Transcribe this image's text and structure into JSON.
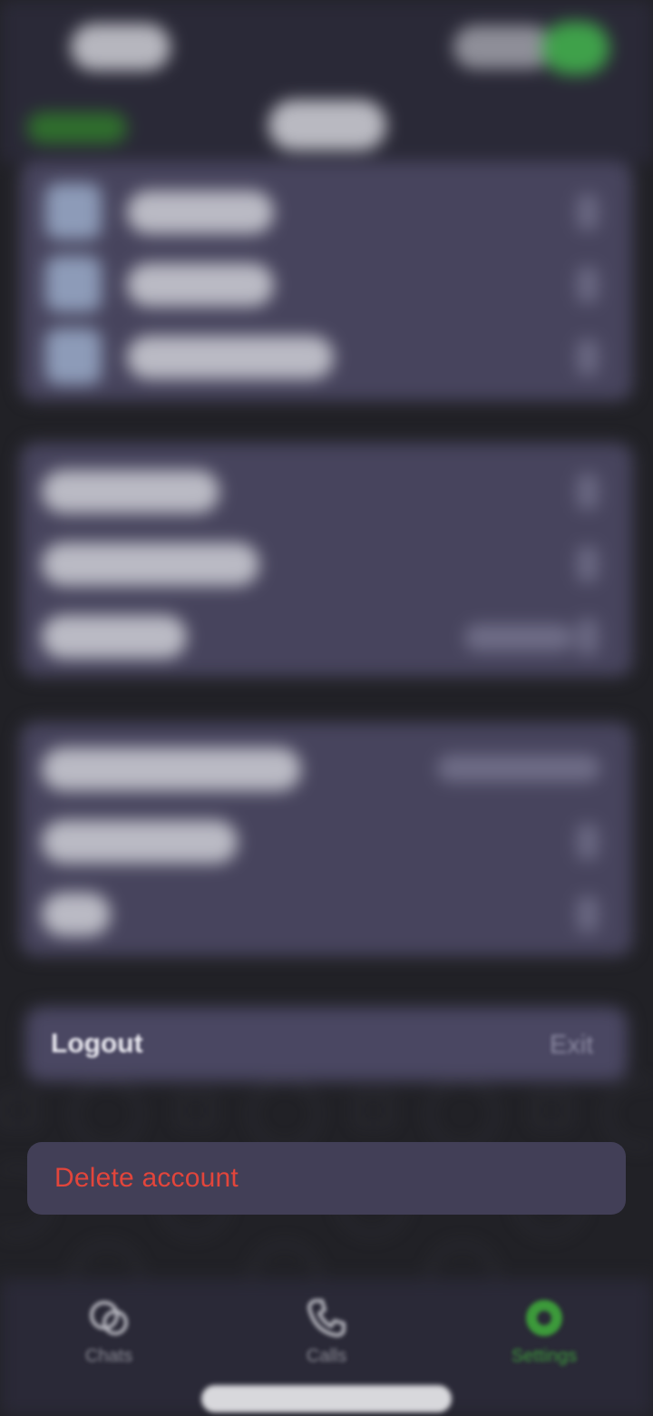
{
  "settings_list": {
    "logout": {
      "label": "Logout",
      "action": "Exit"
    },
    "delete_account": {
      "label": "Delete account"
    }
  },
  "tab_bar": {
    "tabs": [
      {
        "label": "Chats",
        "icon": "chats-icon",
        "active": false
      },
      {
        "label": "Calls",
        "icon": "phone-icon",
        "active": false
      },
      {
        "label": "Settings",
        "icon": "gear-icon",
        "active": true
      }
    ]
  },
  "colors": {
    "destructive": "#e2453b",
    "accent": "#3c9a3a",
    "card": "#423f57",
    "background": "#212126"
  }
}
